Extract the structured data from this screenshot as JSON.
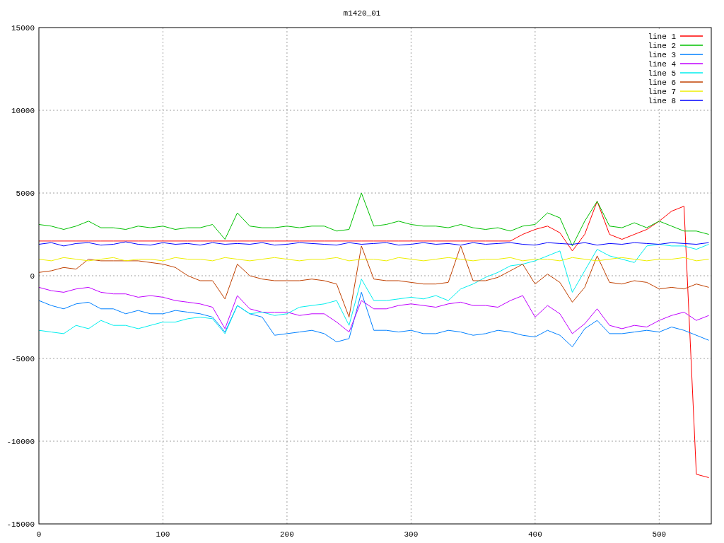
{
  "chart_data": {
    "type": "line",
    "title": "m1420_01",
    "x": [
      0,
      10,
      20,
      30,
      40,
      50,
      60,
      70,
      80,
      90,
      100,
      110,
      120,
      130,
      140,
      150,
      160,
      170,
      180,
      190,
      200,
      210,
      220,
      230,
      240,
      250,
      260,
      270,
      280,
      290,
      300,
      310,
      320,
      330,
      340,
      350,
      360,
      370,
      380,
      390,
      400,
      410,
      420,
      430,
      440,
      450,
      460,
      470,
      480,
      490,
      500,
      510,
      520,
      530,
      540
    ],
    "grid": true,
    "legend": true,
    "xlim": [
      0,
      542
    ],
    "ylim": [
      -15000,
      15000
    ],
    "xticks": [
      0,
      100,
      200,
      300,
      400,
      500
    ],
    "yticks": [
      -15000,
      -10000,
      -5000,
      0,
      5000,
      10000,
      15000
    ],
    "series": [
      {
        "name": "line 1",
        "color": "#ff0000",
        "values": [
          2100,
          2100,
          2100,
          2100,
          2100,
          2100,
          2100,
          2100,
          2100,
          2100,
          2100,
          2100,
          2100,
          2100,
          2100,
          2100,
          2100,
          2100,
          2100,
          2100,
          2100,
          2100,
          2100,
          2100,
          2100,
          2100,
          2100,
          2100,
          2100,
          2100,
          2100,
          2100,
          2100,
          2100,
          2100,
          2100,
          2100,
          2100,
          2100,
          2500,
          2800,
          3000,
          2600,
          1500,
          2500,
          4500,
          2500,
          2200,
          2500,
          2800,
          3300,
          3900,
          4200,
          -12000,
          -12200
        ]
      },
      {
        "name": "line 2",
        "color": "#00c000",
        "values": [
          3100,
          3000,
          2800,
          3000,
          3300,
          2900,
          2900,
          2800,
          3000,
          2900,
          3000,
          2800,
          2900,
          2900,
          3100,
          2200,
          3800,
          3000,
          2900,
          2900,
          3000,
          2900,
          3000,
          3000,
          2700,
          2800,
          5000,
          3000,
          3100,
          3300,
          3100,
          3000,
          3000,
          2900,
          3100,
          2900,
          2800,
          2900,
          2700,
          3000,
          3100,
          3800,
          3500,
          1800,
          3300,
          4500,
          3000,
          2900,
          3200,
          2900,
          3300,
          3000,
          2700,
          2700,
          2500
        ]
      },
      {
        "name": "line 3",
        "color": "#0080ff",
        "values": [
          -1500,
          -1800,
          -2000,
          -1700,
          -1600,
          -2000,
          -2000,
          -2300,
          -2100,
          -2300,
          -2300,
          -2100,
          -2200,
          -2300,
          -2500,
          -3400,
          -1800,
          -2300,
          -2500,
          -3600,
          -3500,
          -3400,
          -3300,
          -3500,
          -4000,
          -3800,
          -1000,
          -3300,
          -3300,
          -3400,
          -3300,
          -3500,
          -3500,
          -3300,
          -3400,
          -3600,
          -3500,
          -3300,
          -3400,
          -3600,
          -3700,
          -3300,
          -3600,
          -4300,
          -3200,
          -2700,
          -3500,
          -3500,
          -3400,
          -3300,
          -3400,
          -3100,
          -3300,
          -3600,
          -3900
        ]
      },
      {
        "name": "line 4",
        "color": "#c000ff",
        "values": [
          -700,
          -900,
          -1000,
          -800,
          -700,
          -1000,
          -1100,
          -1100,
          -1300,
          -1200,
          -1300,
          -1500,
          -1600,
          -1700,
          -1900,
          -3200,
          -1200,
          -2000,
          -2200,
          -2200,
          -2200,
          -2400,
          -2300,
          -2300,
          -2800,
          -3400,
          -1500,
          -2000,
          -2000,
          -1800,
          -1700,
          -1800,
          -1900,
          -1700,
          -1600,
          -1800,
          -1800,
          -1900,
          -1500,
          -1200,
          -2500,
          -1800,
          -2300,
          -3500,
          -2900,
          -2000,
          -3000,
          -3200,
          -3000,
          -3100,
          -2700,
          -2400,
          -2200,
          -2700,
          -2400
        ]
      },
      {
        "name": "line 5",
        "color": "#00eeee",
        "values": [
          -3300,
          -3400,
          -3500,
          -3000,
          -3200,
          -2700,
          -3000,
          -3000,
          -3200,
          -3000,
          -2800,
          -2800,
          -2600,
          -2500,
          -2600,
          -3500,
          -1800,
          -2300,
          -2200,
          -2400,
          -2300,
          -1900,
          -1800,
          -1700,
          -1500,
          -3000,
          -200,
          -1500,
          -1500,
          -1400,
          -1300,
          -1400,
          -1200,
          -1500,
          -800,
          -500,
          -100,
          200,
          600,
          700,
          900,
          1200,
          1500,
          -1000,
          300,
          1600,
          1200,
          1000,
          800,
          1800,
          1900,
          1800,
          1800,
          1600,
          1900
        ]
      },
      {
        "name": "line 6",
        "color": "#c04000",
        "values": [
          200,
          300,
          500,
          400,
          1000,
          900,
          900,
          900,
          900,
          800,
          700,
          500,
          0,
          -300,
          -300,
          -1400,
          700,
          0,
          -200,
          -300,
          -300,
          -300,
          -200,
          -300,
          -500,
          -2500,
          1800,
          -200,
          -300,
          -300,
          -400,
          -500,
          -500,
          -400,
          1800,
          -300,
          -300,
          -100,
          300,
          700,
          -500,
          100,
          -400,
          -1600,
          -700,
          1200,
          -400,
          -500,
          -300,
          -400,
          -800,
          -700,
          -800,
          -500,
          -700
        ]
      },
      {
        "name": "line 7",
        "color": "#eeee00",
        "values": [
          1000,
          900,
          1100,
          1000,
          900,
          1000,
          1100,
          900,
          1000,
          1000,
          900,
          1100,
          1000,
          1000,
          900,
          1100,
          1000,
          900,
          1000,
          1100,
          1000,
          900,
          1000,
          1000,
          1100,
          900,
          1000,
          1000,
          900,
          1100,
          1000,
          900,
          1000,
          1100,
          1000,
          900,
          1000,
          1000,
          1100,
          900,
          1000,
          1000,
          900,
          1100,
          1000,
          900,
          1000,
          1100,
          1000,
          900,
          1000,
          1000,
          1100,
          900,
          1000
        ]
      },
      {
        "name": "line 8",
        "color": "#0000ff",
        "values": [
          1900,
          2000,
          1800,
          1950,
          2000,
          1850,
          1900,
          2050,
          1900,
          1850,
          2000,
          1900,
          1950,
          1850,
          2000,
          1900,
          1950,
          1900,
          2000,
          1850,
          1900,
          2000,
          1950,
          1900,
          1850,
          2000,
          1900,
          1950,
          2000,
          1850,
          1900,
          2000,
          1900,
          1950,
          1850,
          2000,
          1900,
          1950,
          2000,
          1900,
          1850,
          2000,
          1950,
          1900,
          2000,
          1850,
          1950,
          1900,
          2000,
          1950,
          1900,
          2000,
          1950,
          1900,
          2000
        ]
      }
    ]
  }
}
